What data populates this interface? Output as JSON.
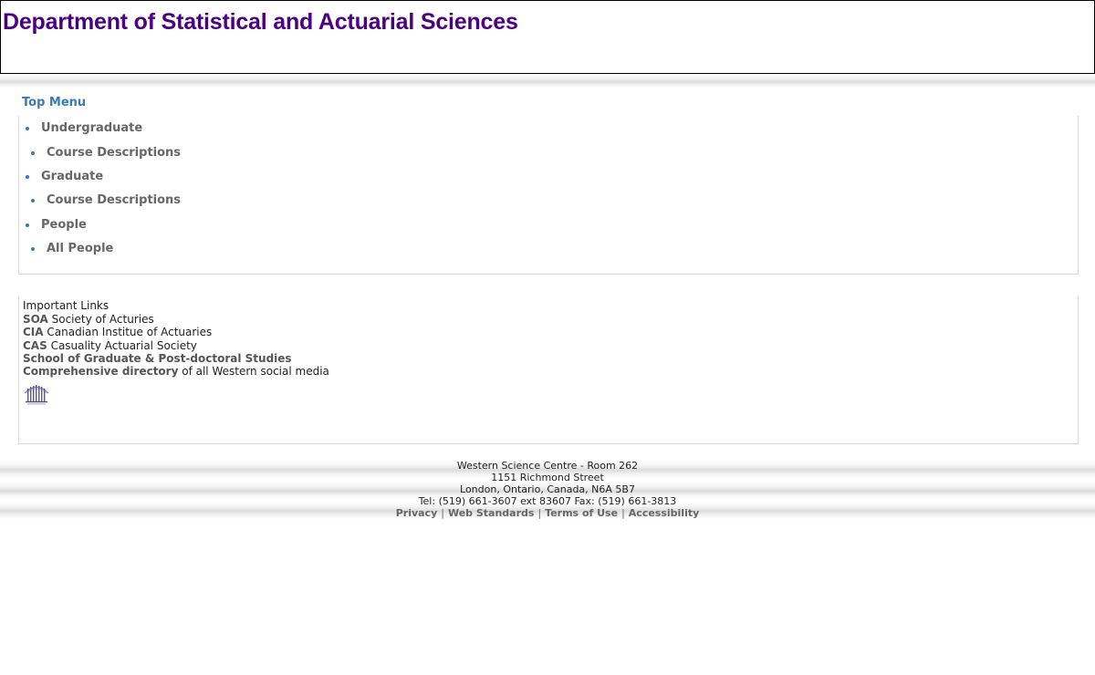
{
  "header": {
    "title": "Department of Statistical and Actuarial Sciences"
  },
  "menu": {
    "heading": "Top Menu",
    "items": [
      {
        "label": "Undergraduate"
      },
      {
        "label": "Course Descriptions"
      },
      {
        "label": "Graduate"
      },
      {
        "label": "Course Descriptions"
      },
      {
        "label": "People"
      },
      {
        "label": "All People"
      }
    ]
  },
  "links": {
    "heading": "Important Links",
    "items": [
      {
        "link": "SOA",
        "text": " Society of Acturies"
      },
      {
        "link": "CIA",
        "text": " Canadian Institue of Actuaries"
      },
      {
        "link": "CAS",
        "text": " Casuality Actuarial Society"
      },
      {
        "link": "School of Graduate & Post-doctoral Studies",
        "text": ""
      },
      {
        "link": "Comprehensive directory",
        "text": " of all Western social media"
      }
    ],
    "logo_icon": "university-crest-icon"
  },
  "footer": {
    "address_line1": "Western Science Centre - Room 262",
    "address_line2": "1151 Richmond Street",
    "address_line3": "London, Ontario, Canada, N6A 5B7",
    "contact": "Tel: (519) 661-3607 ext 83607 Fax: (519) 661-3813",
    "links": [
      "Privacy",
      "Web Standards",
      "Terms of Use",
      "Accessibility"
    ],
    "separator": "|"
  },
  "colors": {
    "title": "#4b0082",
    "accent": "#3a78b8",
    "menu_text": "#666666"
  }
}
